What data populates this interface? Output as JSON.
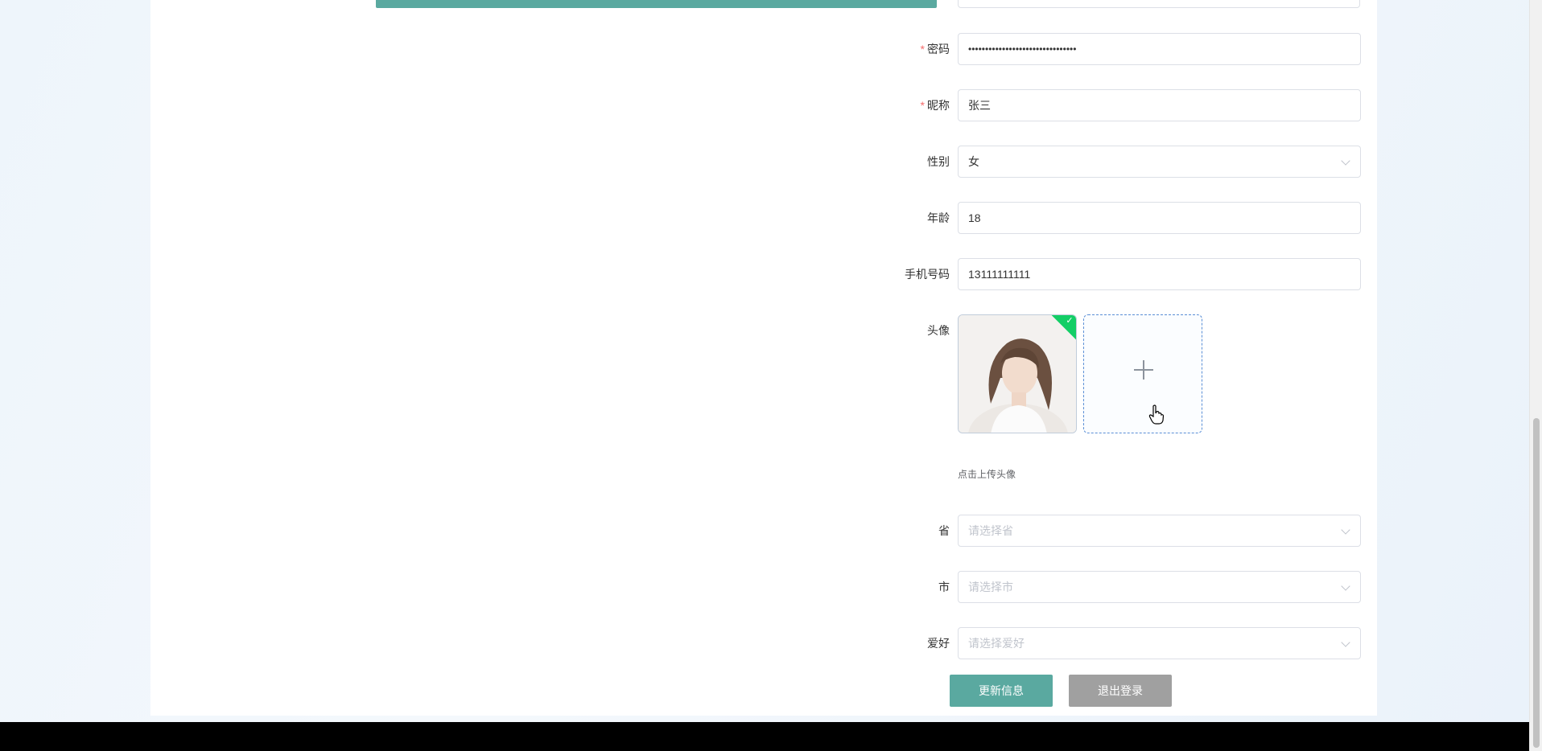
{
  "form": {
    "password": {
      "label": "密码",
      "required": true,
      "value": "••••••••••••••••••••••••••••••••"
    },
    "nickname": {
      "label": "昵称",
      "required": true,
      "value": "张三"
    },
    "gender": {
      "label": "性别",
      "value": "女"
    },
    "age": {
      "label": "年龄",
      "value": "18"
    },
    "phone": {
      "label": "手机号码",
      "value": "13111111111"
    },
    "avatar": {
      "label": "头像",
      "hint": "点击上传头像",
      "uploaded": true
    },
    "province": {
      "label": "省",
      "placeholder": "请选择省"
    },
    "city": {
      "label": "市",
      "placeholder": "请选择市"
    },
    "hobby": {
      "label": "爱好",
      "placeholder": "请选择爱好"
    }
  },
  "buttons": {
    "update": "更新信息",
    "logout": "退出登录"
  },
  "colors": {
    "primary": "#5aa9a0",
    "secondary": "#a0a0a0",
    "required": "#f56c6c",
    "success": "#13ce66"
  }
}
